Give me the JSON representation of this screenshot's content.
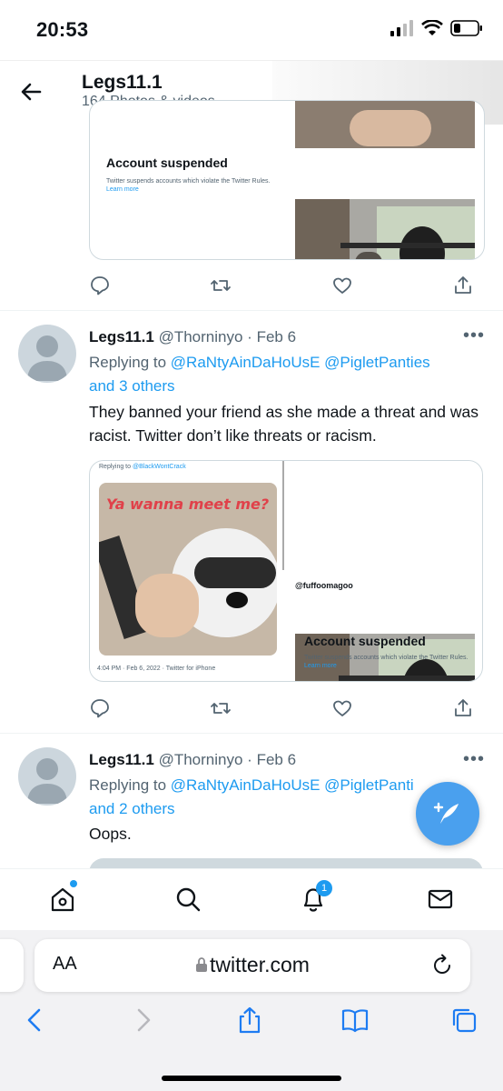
{
  "status_bar": {
    "time": "20:53"
  },
  "header": {
    "name": "Legs11.1",
    "subtitle": "164 Photos & videos"
  },
  "top_card": {
    "suspended_title": "Account suspended",
    "suspended_text": "Twitter suspends accounts which violate the Twitter Rules.",
    "learn_more": "Learn more"
  },
  "tweets": [
    {
      "name": "Legs11.1",
      "handle": "@Thorninyo",
      "sep": "·",
      "date": "Feb 6",
      "replying_prefix": "Replying to",
      "mentions": "@RaNtyAinDaHoUsE @PigletPanties",
      "others": "and 3 others",
      "text": "They banned your friend as she made a threat and was racist. Twitter don’t like threats or racism.",
      "embed": {
        "replying_prefix": "Replying to",
        "replying_handle": "@BlackWontCrack",
        "meme_caption": "Ya wanna meet me?",
        "timestamp": "4:04 PM · Feb 6, 2022 · Twitter for iPhone",
        "handle": "@fuffoomagoo",
        "suspended_title": "Account suspended",
        "suspended_text": "Twitter suspends accounts which violate the Twitter Rules.",
        "learn_more": "Learn more"
      }
    },
    {
      "name": "Legs11.1",
      "handle": "@Thorninyo",
      "sep": "·",
      "date": "Feb 6",
      "replying_prefix": "Replying to",
      "mentions": "@RaNtyAinDaHoUsE @PigletPanti",
      "others": "and 2 others",
      "text": "Oops."
    }
  ],
  "bottom_nav": {
    "notification_count": "1"
  },
  "safari": {
    "aa": "AA",
    "url": "twitter.com"
  },
  "colors": {
    "accent": "#1d9bf0",
    "fab": "#4aa0ee",
    "muted": "#536471"
  },
  "icons": [
    "back-arrow-icon",
    "reply-icon",
    "retweet-icon",
    "like-icon",
    "share-icon",
    "more-icon",
    "compose-icon",
    "home-icon",
    "search-icon",
    "bell-icon",
    "mail-icon",
    "lock-icon",
    "reload-icon",
    "safari-back-icon",
    "safari-forward-icon",
    "safari-share-icon",
    "bookmarks-icon",
    "tabs-icon"
  ]
}
